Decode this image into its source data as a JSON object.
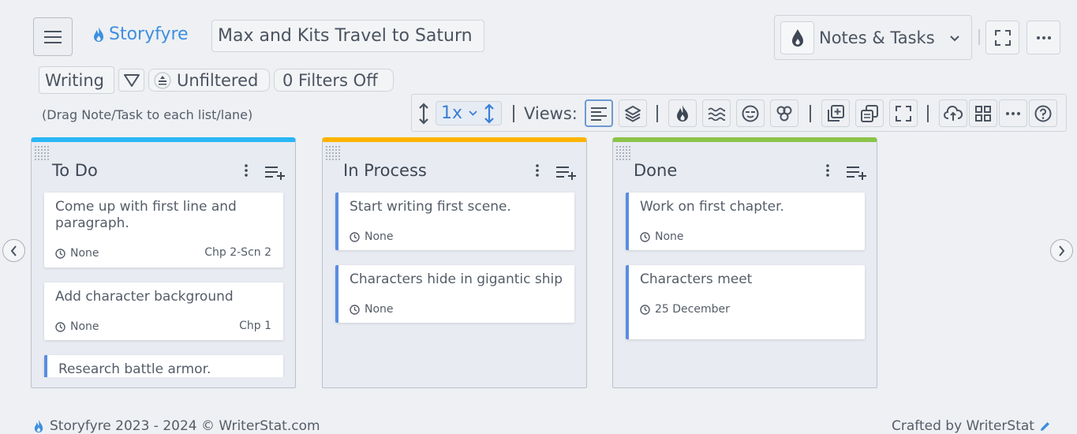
{
  "header": {
    "brand": "Storyfyre",
    "project_title": "Max and Kits Travel to Saturn",
    "notes_tasks_label": "Notes & Tasks"
  },
  "filters": {
    "mode": "Writing",
    "filter_state": "Unfiltered",
    "filters_off": "0 Filters Off"
  },
  "drag_hint": "(Drag Note/Task to each list/lane)",
  "toolbar": {
    "speed": "1x",
    "views_label": "Views:"
  },
  "columns": [
    {
      "title": "To Do",
      "accent": "#29b6f6",
      "cards": [
        {
          "title": "Come up with first line and paragraph.",
          "date": "None",
          "ref": "Chp 2-Scn 2"
        },
        {
          "title": "Add character background",
          "date": "None",
          "ref": "Chp 1"
        },
        {
          "title": "Research battle armor.",
          "date": "",
          "ref": ""
        }
      ]
    },
    {
      "title": "In Process",
      "accent": "#ffb300",
      "cards": [
        {
          "title": "Start writing first scene.",
          "date": "None",
          "ref": ""
        },
        {
          "title": "Characters hide in gigantic ship",
          "date": "None",
          "ref": ""
        }
      ]
    },
    {
      "title": "Done",
      "accent": "#8bc34a",
      "cards": [
        {
          "title": "Work on first chapter.",
          "date": "None",
          "ref": ""
        },
        {
          "title": "Characters meet",
          "date": "25 December",
          "ref": ""
        }
      ]
    }
  ],
  "footer": {
    "copyright": "Storyfyre 2023 - 2024 ©  WriterStat.com",
    "crafted": "Crafted by WriterStat"
  },
  "colors": {
    "brand_blue": "#3d8fe0",
    "card_stripe": "#5a8ce0"
  },
  "icons": [
    "menu-icon",
    "flame-icon",
    "drop-icon",
    "chevron-down-icon",
    "fullscreen-icon",
    "more-horizontal-icon",
    "filter-icon",
    "unfiltered-icon",
    "vertical-arrows-icon",
    "align-left-icon",
    "layers-icon",
    "waves-icon",
    "face-icon",
    "blocks-icon",
    "add-note-icon",
    "copy-icon",
    "cloud-sync-icon",
    "grid-icon",
    "help-icon",
    "clock-icon",
    "kebab-icon",
    "playlist-add-icon",
    "chevron-left-icon",
    "chevron-right-icon",
    "pencil-icon"
  ]
}
